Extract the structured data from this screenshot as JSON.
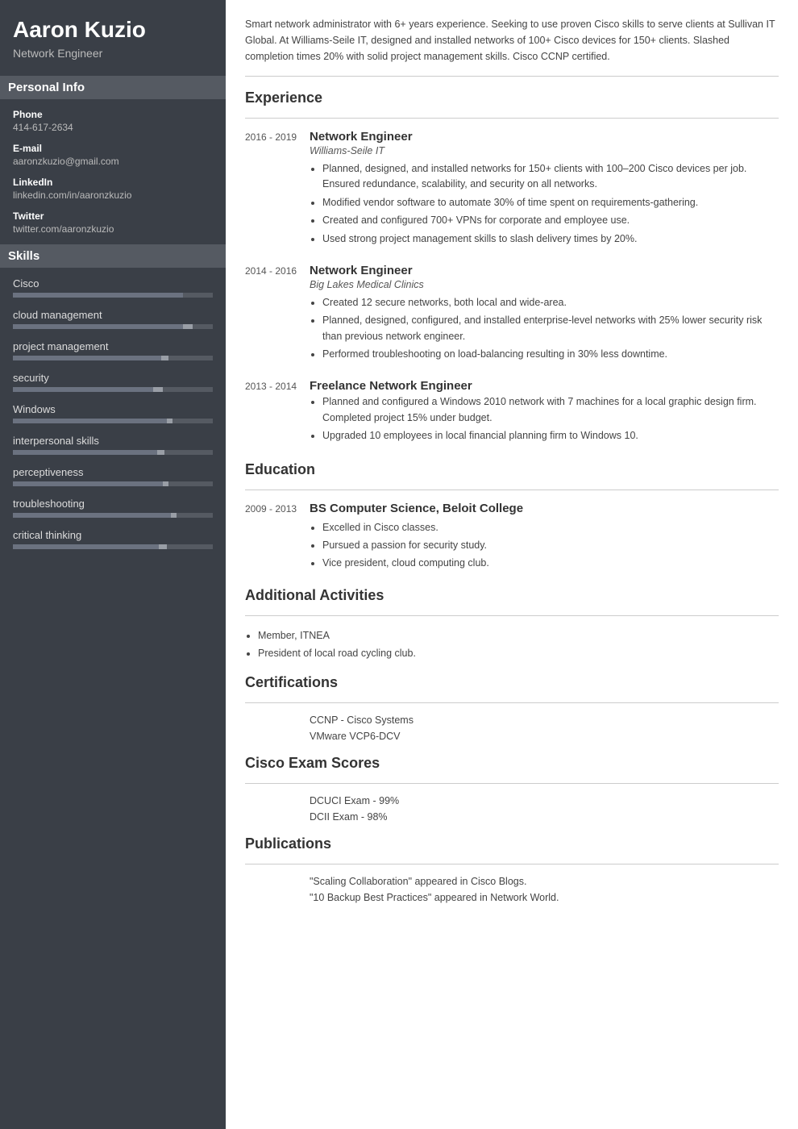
{
  "person": {
    "name": "Aaron Kuzio",
    "title": "Network Engineer"
  },
  "sidebar": {
    "personal_info_header": "Personal Info",
    "phone_label": "Phone",
    "phone_value": "414-617-2634",
    "email_label": "E-mail",
    "email_value": "aaronzkuzio@gmail.com",
    "linkedin_label": "LinkedIn",
    "linkedin_value": "linkedin.com/in/aaronzkuzio",
    "twitter_label": "Twitter",
    "twitter_value": "twitter.com/aaronzkuzio",
    "skills_header": "Skills",
    "skills": [
      {
        "name": "Cisco",
        "fill_pct": 85,
        "accent_start": 85,
        "accent_pct": 0
      },
      {
        "name": "cloud management",
        "fill_pct": 90,
        "accent_start": 85,
        "accent_pct": 5
      },
      {
        "name": "project management",
        "fill_pct": 78,
        "accent_start": 74,
        "accent_pct": 4
      },
      {
        "name": "security",
        "fill_pct": 75,
        "accent_start": 70,
        "accent_pct": 5
      },
      {
        "name": "Windows",
        "fill_pct": 80,
        "accent_start": 77,
        "accent_pct": 3
      },
      {
        "name": "interpersonal skills",
        "fill_pct": 76,
        "accent_start": 72,
        "accent_pct": 4
      },
      {
        "name": "perceptiveness",
        "fill_pct": 78,
        "accent_start": 75,
        "accent_pct": 3
      },
      {
        "name": "troubleshooting",
        "fill_pct": 82,
        "accent_start": 79,
        "accent_pct": 3
      },
      {
        "name": "critical thinking",
        "fill_pct": 77,
        "accent_start": 73,
        "accent_pct": 4
      }
    ]
  },
  "summary": "Smart network administrator with 6+ years experience. Seeking to use proven Cisco skills to serve clients at Sullivan IT Global. At Williams-Seile IT, designed and installed networks of 100+ Cisco devices for 150+ clients. Slashed completion times 20% with solid project management skills. Cisco CCNP certified.",
  "sections": {
    "experience_title": "Experience",
    "education_title": "Education",
    "activities_title": "Additional Activities",
    "certifications_title": "Certifications",
    "exam_scores_title": "Cisco Exam Scores",
    "publications_title": "Publications"
  },
  "experience": [
    {
      "dates": "2016 - 2019",
      "title": "Network Engineer",
      "company": "Williams-Seile IT",
      "bullets": [
        "Planned, designed, and installed networks for 150+ clients with 100–200 Cisco devices per job. Ensured redundance, scalability, and security on all networks.",
        "Modified vendor software to automate 30% of time spent on requirements-gathering.",
        "Created and configured 700+ VPNs for corporate and employee use.",
        "Used strong project management skills to slash delivery times by 20%."
      ]
    },
    {
      "dates": "2014 - 2016",
      "title": "Network Engineer",
      "company": "Big Lakes Medical Clinics",
      "bullets": [
        "Created 12 secure networks, both local and wide-area.",
        "Planned, designed, configured, and installed enterprise-level networks with 25% lower security risk than previous network engineer.",
        "Performed troubleshooting on load-balancing resulting in 30% less downtime."
      ]
    },
    {
      "dates": "2013 - 2014",
      "title": "Freelance Network Engineer",
      "company": "",
      "bullets": [
        "Planned and configured a Windows 2010 network with 7 machines for a local graphic design firm. Completed project 15% under budget.",
        "Upgraded 10 employees in local financial planning firm to Windows 10."
      ]
    }
  ],
  "education": [
    {
      "dates": "2009 - 2013",
      "degree": "BS Computer Science, Beloit College",
      "bullets": [
        "Excelled in Cisco classes.",
        "Pursued a passion for security study.",
        "Vice president, cloud computing club."
      ]
    }
  ],
  "activities": [
    "Member, ITNEA",
    "President of local road cycling club."
  ],
  "certifications": [
    "CCNP - Cisco Systems",
    "VMware VCP6-DCV"
  ],
  "exam_scores": [
    "DCUCI Exam - 99%",
    "DCII Exam - 98%"
  ],
  "publications": [
    "\"Scaling Collaboration\" appeared in Cisco Blogs.",
    "\"10 Backup Best Practices\" appeared in Network World."
  ]
}
